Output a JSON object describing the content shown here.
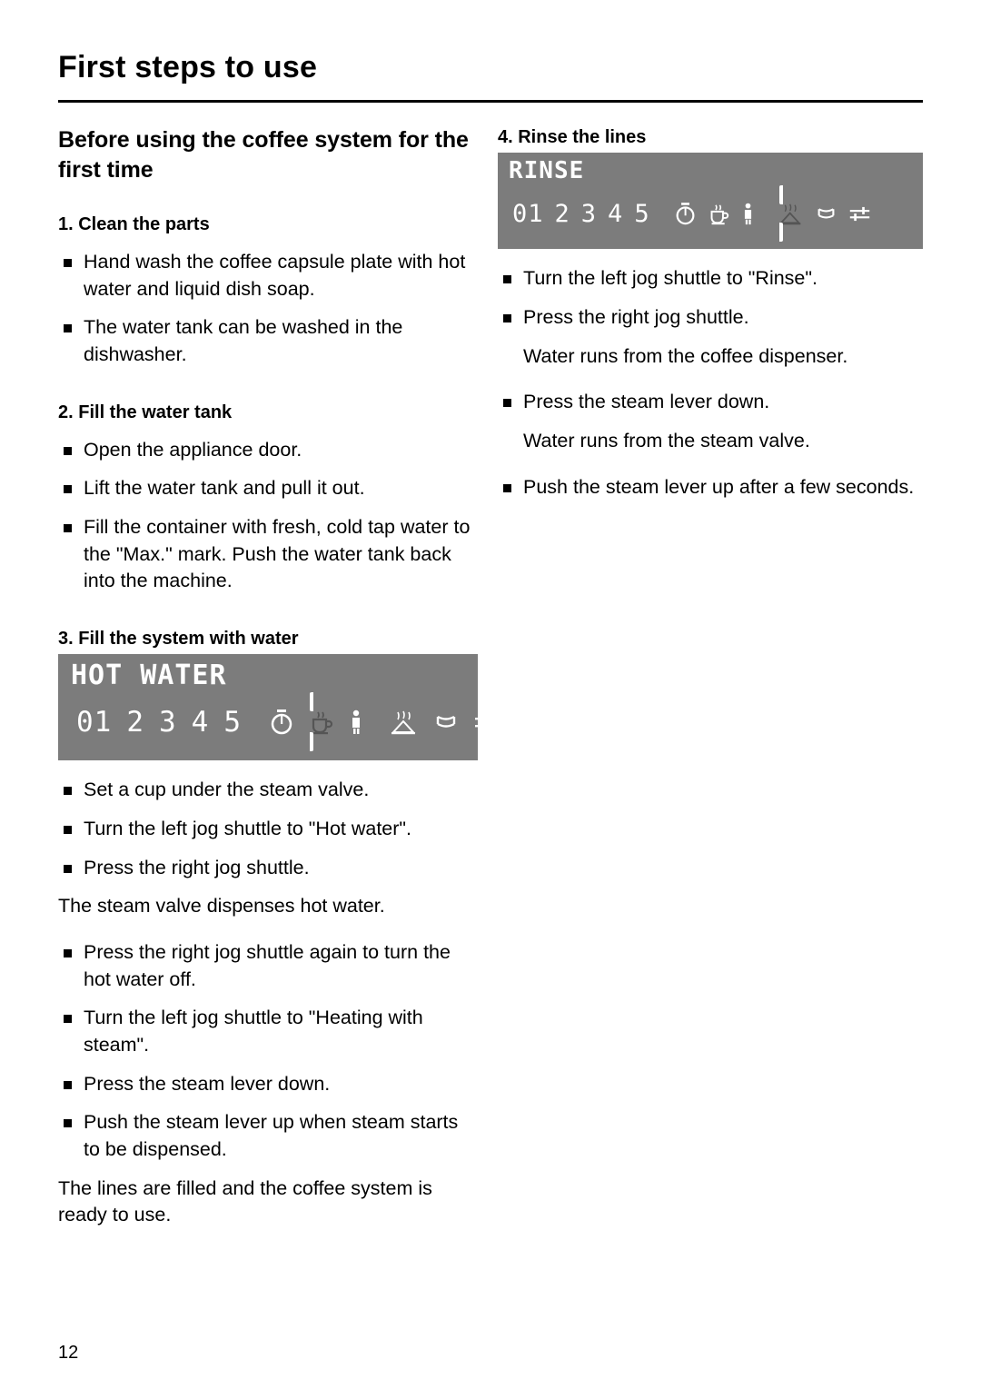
{
  "page": {
    "title": "First steps to use",
    "number": "12"
  },
  "left": {
    "section_title": "Before using the coffee system for the first time",
    "step1": {
      "heading": "1. Clean the parts",
      "bullets": [
        "Hand wash the coffee capsule plate with hot water and liquid dish soap.",
        "The water tank can be washed in the dishwasher."
      ]
    },
    "step2": {
      "heading": "2. Fill the water tank",
      "bullets": [
        "Open the appliance door.",
        "Lift the water tank and pull it out.",
        "Fill the container with fresh, cold tap water to the \"Max.\" mark. Push the water tank back into the machine."
      ]
    },
    "step3": {
      "heading": "3. Fill the system with water",
      "display": {
        "title": "HOT WATER",
        "numbers": [
          "01",
          "2",
          "3",
          "4",
          "5"
        ],
        "icons": [
          "timer-icon",
          "cup-icon",
          "person-icon",
          "steam-icon",
          "cup-stack-icon",
          "sliders-icon"
        ],
        "selected_icon": "cup-icon"
      },
      "bullets_a": [
        "Set a cup under the steam valve.",
        "Turn the left jog shuttle to \"Hot water\".",
        "Press the right jog shuttle."
      ],
      "note_a": "The steam valve dispenses hot water.",
      "bullets_b": [
        "Press the right jog shuttle again to turn the hot water off.",
        "Turn the left jog shuttle to \"Heating with steam\".",
        "Press the steam lever down.",
        "Push the steam lever up when steam starts to be dispensed."
      ],
      "note_b": "The lines are filled and the coffee system is ready to use."
    }
  },
  "right": {
    "step4": {
      "heading": "4. Rinse the lines",
      "display": {
        "title": "RINSE",
        "numbers": [
          "01",
          "2",
          "3",
          "4",
          "5"
        ],
        "icons": [
          "timer-icon",
          "cup-icon",
          "person-icon",
          "steam-icon",
          "cup-stack-icon",
          "sliders-icon"
        ],
        "selected_icon": "steam-icon"
      },
      "bullets_a": [
        "Turn the left jog shuttle to \"Rinse\".",
        "Press the right jog shuttle."
      ],
      "note_a": "Water runs from the coffee dispenser.",
      "bullets_b": [
        "Press the steam lever down."
      ],
      "note_b": "Water runs from the steam valve.",
      "bullets_c": [
        "Push the steam lever up after a few seconds."
      ]
    }
  }
}
